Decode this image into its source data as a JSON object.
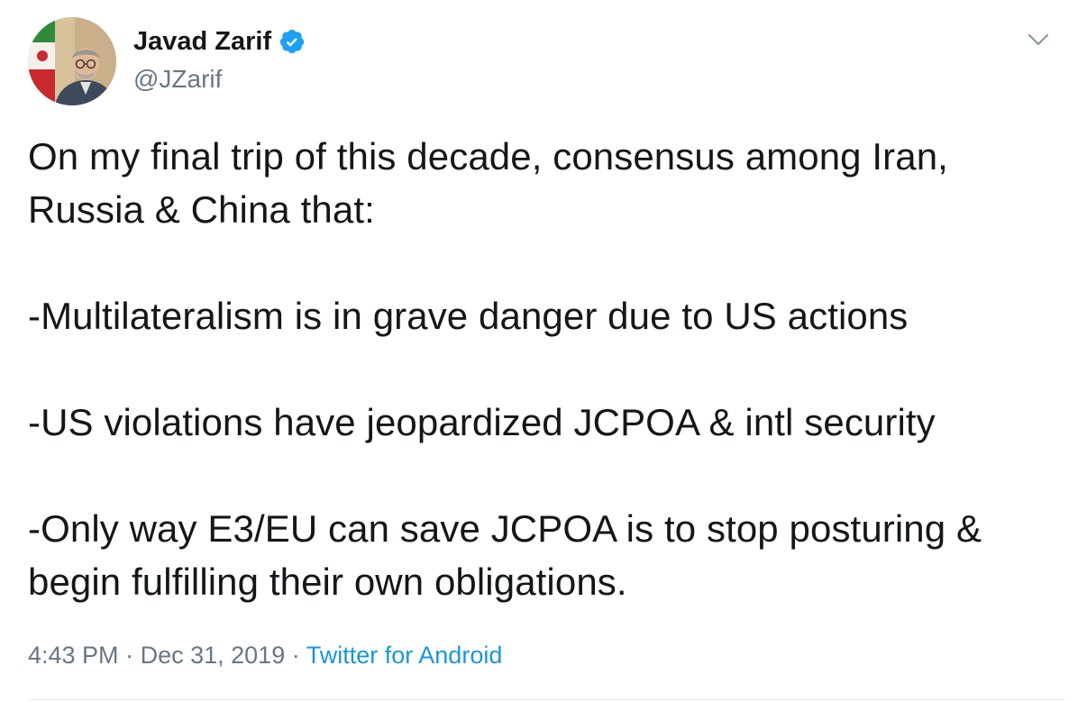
{
  "user": {
    "display_name": "Javad Zarif",
    "handle": "@JZarif",
    "verified": true
  },
  "tweet": {
    "paragraphs": [
      "On my final trip of this decade, consensus among Iran, Russia & China that:",
      "-Multilateralism is in grave danger due to US actions",
      "-US violations have jeopardized JCPOA & intl security",
      "-Only way E3/EU can save JCPOA is to stop posturing & begin fulfilling their own obligations."
    ]
  },
  "meta": {
    "time": "4:43 PM",
    "separator": "·",
    "date": "Dec 31, 2019",
    "source": "Twitter for Android"
  },
  "icons": {
    "verified": "verified-badge-icon",
    "caret": "chevron-down-icon"
  },
  "colors": {
    "text": "#14171a",
    "secondary": "#657786",
    "link": "#1b95e0",
    "verified": "#1da1f2"
  }
}
